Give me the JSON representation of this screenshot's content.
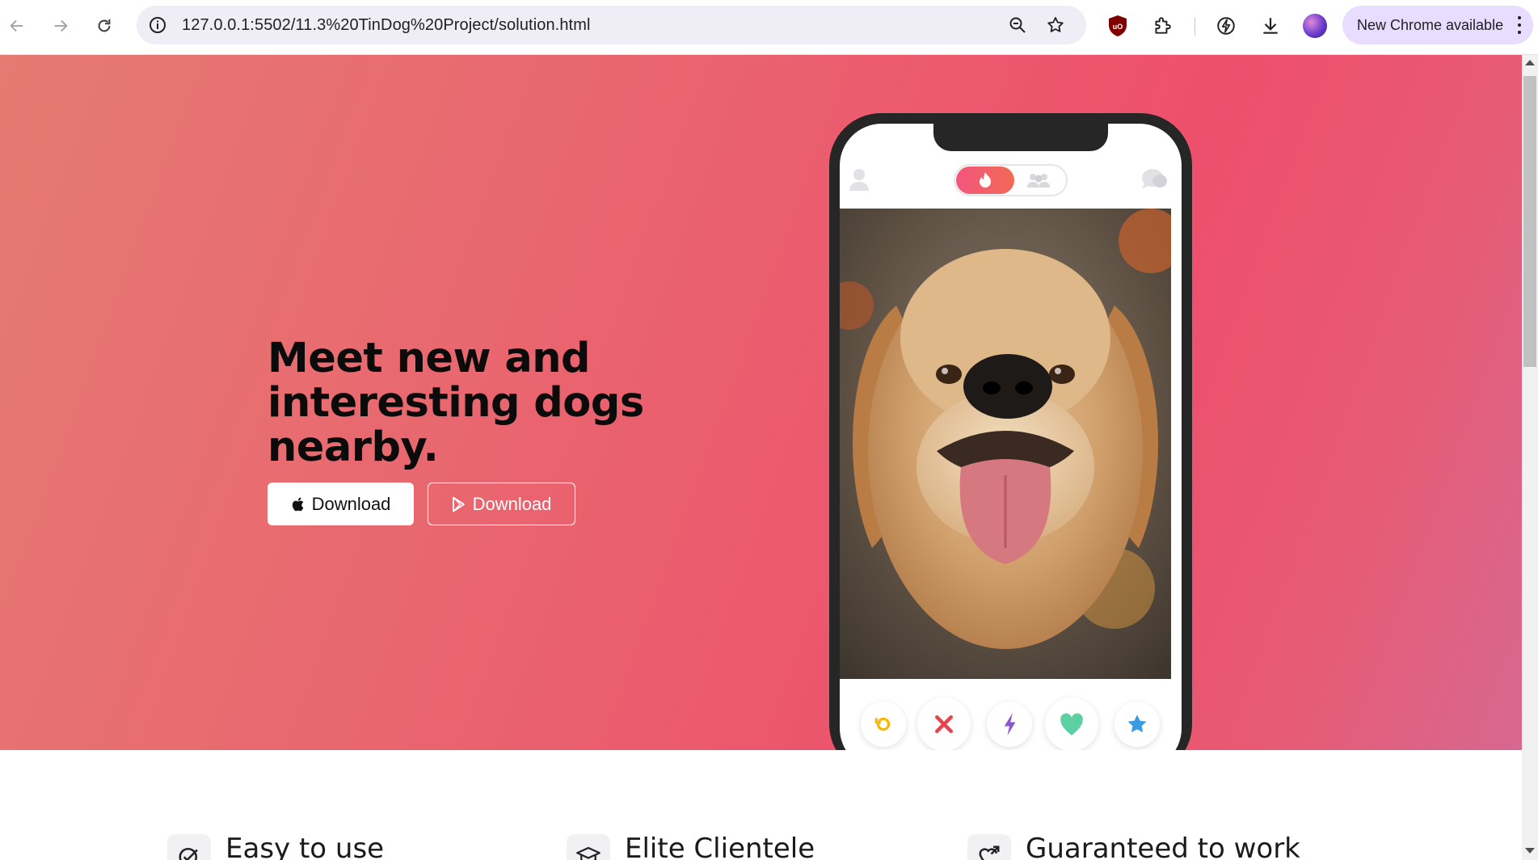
{
  "browser": {
    "url": "127.0.0.1:5502/11.3%20TinDog%20Project/solution.html",
    "update_label": "New Chrome available",
    "icons": [
      "back-icon",
      "forward-icon",
      "reload-icon",
      "site-info-icon",
      "zoom-icon",
      "bookmark-star-icon",
      "ublock-icon",
      "extensions-icon",
      "performance-icon",
      "download-icon",
      "profile-avatar"
    ]
  },
  "hero": {
    "headline": "Meet new and interesting dogs nearby.",
    "apple_download": "Download",
    "play_download": "Download"
  },
  "phone": {
    "buttons": [
      "rewind-icon",
      "nope-icon",
      "boost-icon",
      "like-icon",
      "superlike-icon"
    ],
    "colors": {
      "rewind": "#f5b800",
      "nope": "#e8444f",
      "boost": "#8b55cc",
      "like": "#5dd0a3",
      "superlike": "#3b9be0"
    }
  },
  "features": [
    {
      "title": "Easy to use",
      "icon": "check-circle-icon"
    },
    {
      "title": "Elite Clientele",
      "icon": "graduation-cap-icon"
    },
    {
      "title": "Guaranteed to work",
      "icon": "heart-arrow-icon"
    }
  ]
}
